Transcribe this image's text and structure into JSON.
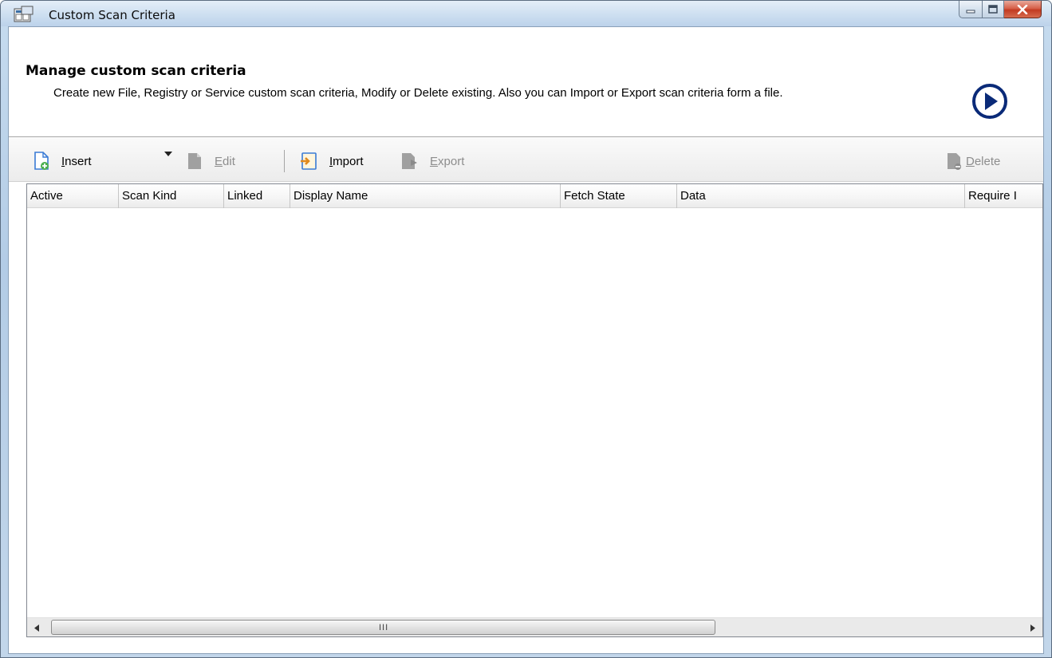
{
  "window": {
    "title": "Custom Scan Criteria"
  },
  "header": {
    "title": "Manage custom scan criteria",
    "description": "Create new File, Registry or Service custom scan criteria, Modify or Delete existing. Also you can Import or Export scan criteria form a file."
  },
  "toolbar": {
    "insert": {
      "label_first": "I",
      "label_rest": "nsert"
    },
    "edit": {
      "label_first": "E",
      "label_rest": "dit"
    },
    "import": {
      "label_first": "I",
      "label_rest": "mport"
    },
    "export": {
      "label_first": "E",
      "label_rest": "xport"
    },
    "delete": {
      "label_first": "D",
      "label_rest": "elete"
    }
  },
  "table": {
    "columns": [
      "Active",
      "Scan Kind",
      "Linked",
      "Display Name",
      "Fetch State",
      "Data",
      "Require I"
    ]
  },
  "scrollbar": {
    "grip": "III"
  },
  "colors": {
    "go_button": "#0a2a78",
    "accent_icon_blue": "#3a7bd5",
    "disabled_icon": "#9a9a9a",
    "import_orange": "#e08a1e"
  }
}
